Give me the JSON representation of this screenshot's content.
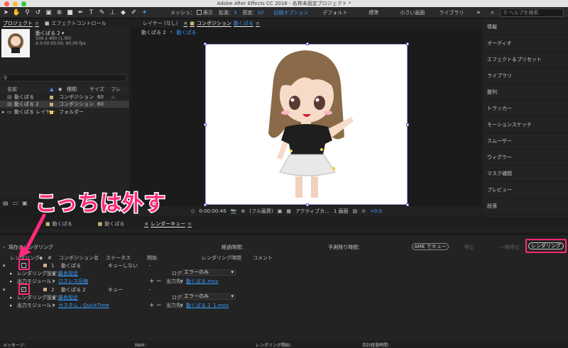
{
  "window": {
    "title": "Adobe After Effects CC 2018 - 名称未設定プロジェクト *"
  },
  "toolbar": {
    "tools": [
      "selection-tool",
      "hand-tool",
      "zoom-tool",
      "rotate-tool",
      "camera-tool",
      "pan-behind-tool",
      "rectangle-tool",
      "pen-tool",
      "type-tool",
      "brush-tool",
      "clone-stamp-tool",
      "eraser-tool",
      "roto-brush-tool",
      "puppet-pin-tool"
    ],
    "mesh_label": "メッシュ：",
    "display_label": "表示",
    "expand_label": "拡張：",
    "expand_value": "3",
    "density_label": "密度：",
    "density_value": "10",
    "workspaces": [
      "記録オプション",
      "デフォルト",
      "標準",
      "小さい画面",
      "ライブラリ"
    ],
    "help_search_placeholder": "ヘルプを検索"
  },
  "project_panel": {
    "tab_project": "プロジェクト",
    "tab_effects": "エフェクトコントロール",
    "thumb_name": "動くぱる 2 ▾",
    "thumb_info1": "500 x 400 (1.00)",
    "thumb_info2": "Δ 0:00:05:00, 60.00 fps",
    "search_placeholder": "",
    "col_name": "名前",
    "col_type": "種類",
    "col_size": "サイズ",
    "col_fr": "フレ",
    "items": [
      {
        "name": "動くぱる",
        "type": "コンポジション",
        "size": "60",
        "color": "#c9b07a"
      },
      {
        "name": "動くぱる 2",
        "type": "コンポジション",
        "size": "60",
        "color": "#c9b07a"
      },
      {
        "name": "動くぱる レイヤー",
        "type": "フォルダー",
        "size": "",
        "color": "#e6c84a"
      }
    ]
  },
  "viewer": {
    "tab_layer": "レイヤー (なし)",
    "tab_comp_prefix": "コンポジション",
    "tab_comp_name": "動くぱる",
    "crumb1": "動くぱる 2",
    "crumb2": "動くぱる",
    "timecode": "0:00:00:46",
    "quality": "(フル画質)",
    "active_camera": "アクティブカ...",
    "views": "1 画面",
    "offset": "+0.0"
  },
  "right_panel": {
    "items": [
      "情報",
      "オーディオ",
      "エフェクト＆プリセット",
      "ライブラリ",
      "整列",
      "トラッカー",
      "モーションスケッチ",
      "スムーザー",
      "ウィグラー",
      "マスク補間",
      "プレビュー",
      "段落"
    ]
  },
  "bottom_tabs": {
    "tab1": "動くぱる",
    "tab2": "動くぱる",
    "tab3": "レンダーキュー"
  },
  "render_queue": {
    "current_render_label": "現在のレンダリング",
    "elapsed_label": "経過時間：",
    "remaining_label": "予測残り時間：",
    "ame_button": "AME でキュー",
    "stop_button": "停止",
    "pause_button": "一時停止",
    "render_button": "レンダリング",
    "col_render": "レンダリング",
    "col_num": "#",
    "col_comp": "コンポジション名",
    "col_status": "ステータス",
    "col_start": "開始",
    "col_render_time": "レンダリング時間",
    "col_comment": "コメント",
    "items": [
      {
        "num": "1",
        "comp": "動くぱる",
        "status": "キューしない",
        "start": "-",
        "checked": false,
        "render_settings_label": "レンダリング設定：",
        "render_settings_value": "最良設定",
        "output_module_label": "出力モジュール：",
        "output_module_value": "ロスレス圧縮",
        "log_label": "ログ：",
        "log_value": "エラーのみ",
        "output_to_label": "出力先：",
        "output_to_value": "動くぱる.mov"
      },
      {
        "num": "2",
        "comp": "動くぱる 2",
        "status": "キュー",
        "start": "-",
        "checked": true,
        "render_settings_label": "レンダリング設定：",
        "render_settings_value": "最良設定",
        "output_module_label": "出力モジュール：",
        "output_module_value": "カスタム : QuickTime",
        "log_label": "ログ：",
        "log_value": "エラーのみ",
        "output_to_label": "出力先：",
        "output_to_value": "動くぱる 2_1.mov"
      }
    ]
  },
  "statusbar": {
    "message": "メッセージ：",
    "ram": "RAM：",
    "render_start": "レンダリング開始：",
    "total_elapsed": "合計経過時間："
  },
  "annotation": {
    "callout_text": "こっちは外す"
  },
  "colors": {
    "accent": "#3b9cff",
    "highlight": "#ff2a7a"
  }
}
